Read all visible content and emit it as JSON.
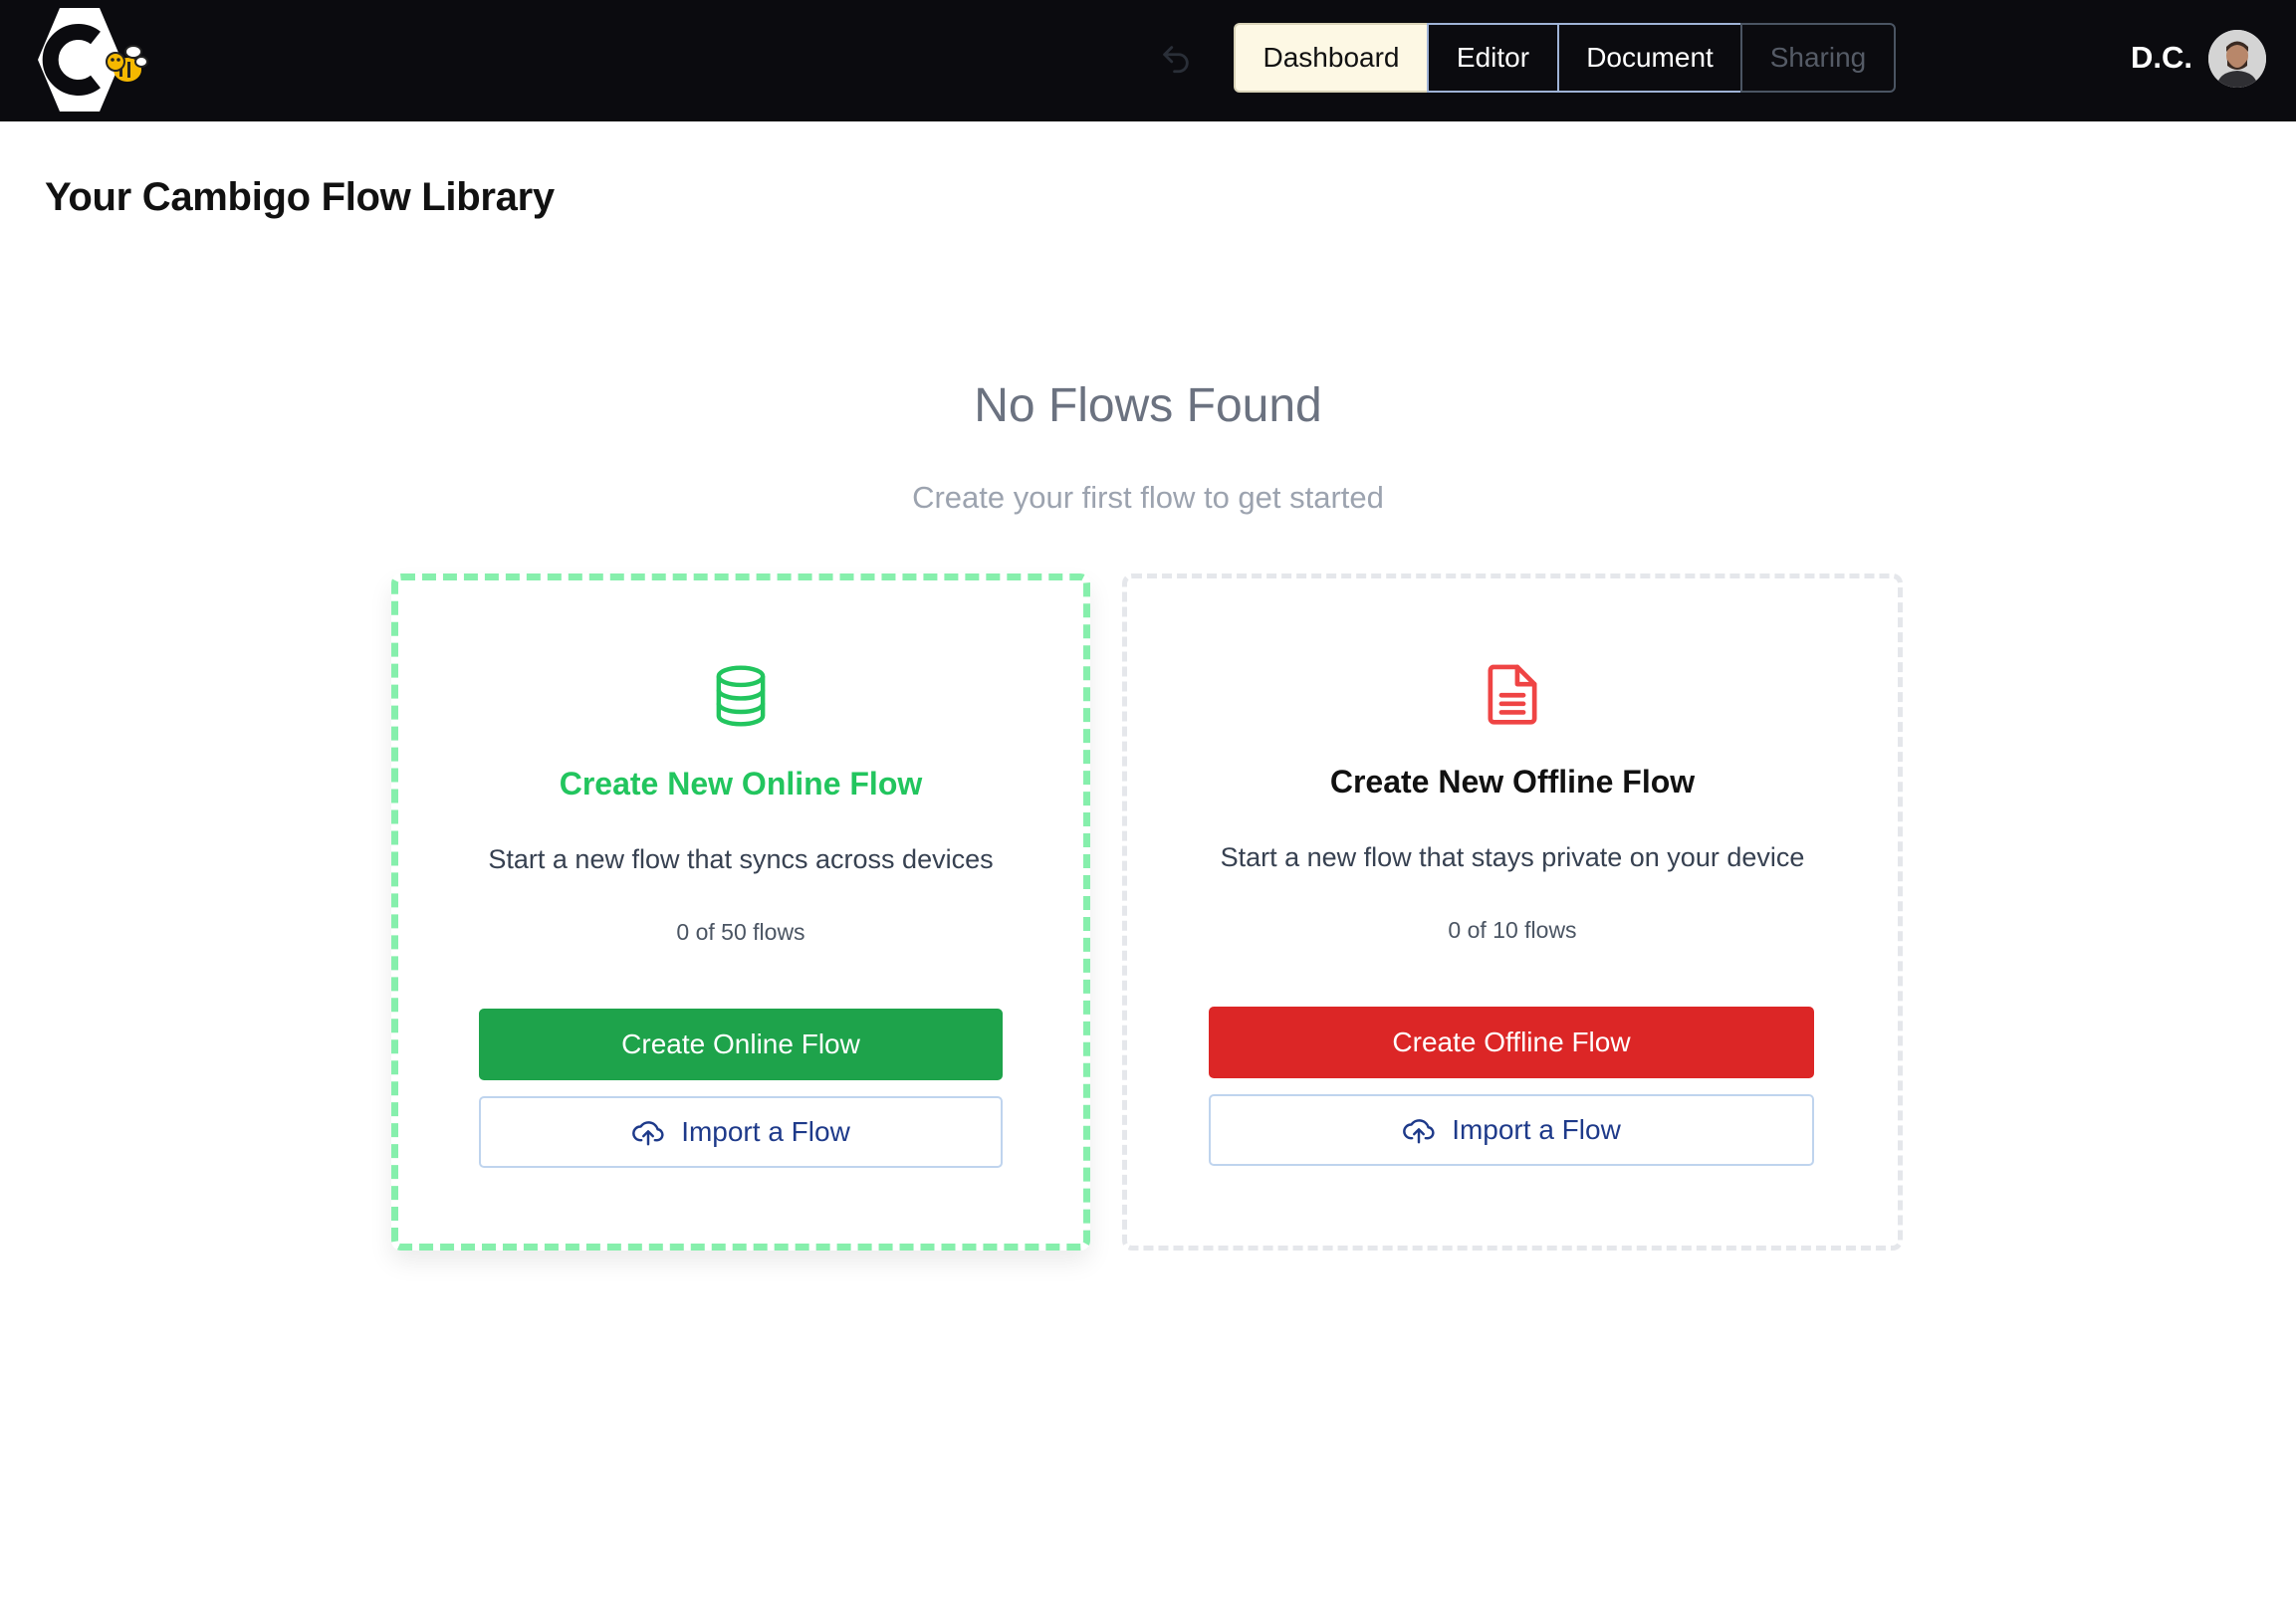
{
  "header": {
    "logo_icon": "cambigo-bee-logo",
    "undo_icon": "undo-icon",
    "tabs": [
      {
        "label": "Dashboard",
        "state": "active"
      },
      {
        "label": "Editor",
        "state": "normal"
      },
      {
        "label": "Document",
        "state": "normal"
      },
      {
        "label": "Sharing",
        "state": "disabled"
      }
    ],
    "user_initials": "D.C.",
    "avatar_icon": "user-avatar"
  },
  "page": {
    "title": "Your Cambigo Flow Library"
  },
  "empty_state": {
    "title": "No Flows Found",
    "subtitle": "Create your first flow to get started"
  },
  "cards": {
    "online": {
      "icon": "database-icon",
      "title": "Create New Online Flow",
      "description": "Start a new flow that syncs across devices",
      "count": "0 of 50 flows",
      "primary_button": "Create Online Flow",
      "import_button": "Import a Flow",
      "accent_color": "#22c55e",
      "button_color": "#1ea34b",
      "selected": true
    },
    "offline": {
      "icon": "document-icon",
      "title": "Create New Offline Flow",
      "description": "Start a new flow that stays private on your device",
      "count": "0 of 10 flows",
      "primary_button": "Create Offline Flow",
      "import_button": "Import a Flow",
      "accent_color": "#ef4444",
      "button_color": "#dc2626",
      "selected": false
    }
  }
}
